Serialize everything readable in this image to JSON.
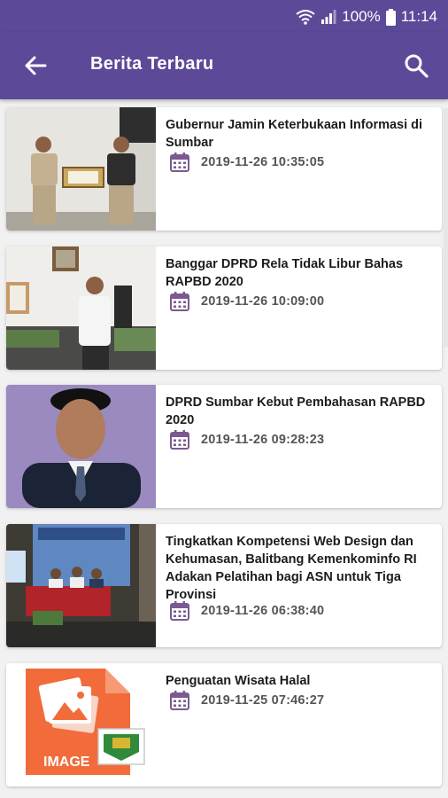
{
  "status_bar": {
    "battery": "100%",
    "time": "11:14"
  },
  "app_bar": {
    "title": "Berita Terbaru"
  },
  "news": [
    {
      "title": "Gubernur Jamin Keterbukaan Informasi di Sumbar",
      "date": "2019-11-26 10:35:05"
    },
    {
      "title": "Banggar DPRD Rela Tidak Libur Bahas RAPBD 2020",
      "date": "2019-11-26 10:09:00"
    },
    {
      "title": "DPRD Sumbar Kebut Pembahasan RAPBD 2020",
      "date": "2019-11-26 09:28:23"
    },
    {
      "title": "Tingkatkan Kompetensi Web Design dan Kehumasan, Balitbang Kemenkominfo RI Adakan Pelatihan bagi ASN untuk Tiga Provinsi",
      "date": "2019-11-26 06:38:40"
    },
    {
      "title": "Penguatan Wisata Halal",
      "date": "2019-11-25 07:46:27",
      "placeholder_text": "IMAGE"
    }
  ],
  "colors": {
    "primary": "#5c4a99",
    "icon": "#7a5a90",
    "placeholder": "#f26b3a"
  }
}
